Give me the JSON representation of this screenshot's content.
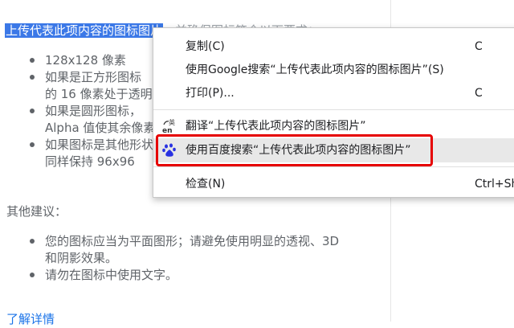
{
  "page": {
    "intro_highlight": "上传代表此项内容的图标图片",
    "intro_rest": "，并确保图标符合以下要求：",
    "requirements": [
      "128x128 像素",
      "如果是正方形图标",
      "的 16 像素处于透明",
      "如果是圆形图标，",
      "Alpha 值使其余像素",
      "如果图标是其他形状",
      "同样保持 96x96"
    ],
    "other_title": "其他建议：",
    "suggestions": [
      "您的图标应当为平面图形；请避免使用明显的透视、3D",
      "和阴影效果。",
      "请勿在图标中使用文字。"
    ],
    "learn_more": "了解详情"
  },
  "menu": {
    "copy": {
      "label": "复制(C)",
      "shortcut": "C"
    },
    "google": {
      "label": "使用Google搜索“上传代表此项内容的图标图片”(S)"
    },
    "print": {
      "label": "打印(P)...",
      "shortcut": "C"
    },
    "translate": {
      "label": "翻译“上传代表此项内容的图标图片”",
      "icon": "translate-icon"
    },
    "baidu": {
      "label": "使用百度搜索“上传代表此项内容的图标图片”",
      "icon": "baidu-paw-icon"
    },
    "inspect": {
      "label": "检查(N)",
      "shortcut": "Ctrl+Sh"
    }
  },
  "colors": {
    "highlight": "#3b78e7",
    "annotation": "#e60000",
    "hover": "#e8e8e8"
  }
}
